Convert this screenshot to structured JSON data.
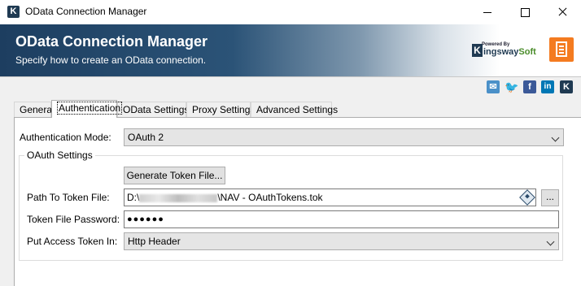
{
  "window": {
    "title": "OData Connection Manager",
    "app_icon": "K"
  },
  "banner": {
    "title": "OData Connection Manager",
    "subtitle": "Specify how to create an OData connection.",
    "logo": {
      "powered_by": "Powered By",
      "brand_k": "K",
      "brand_main": "ingsway",
      "brand_soft": "Soft"
    },
    "colors": {
      "dark": "#1d3e60",
      "accent": "#f47b20"
    }
  },
  "social": {
    "twitter": "t",
    "facebook": "f",
    "linkedin": "in",
    "kingsway": "K"
  },
  "tabs": [
    {
      "label": "General"
    },
    {
      "label": "Authentication",
      "active": true
    },
    {
      "label": "OData Settings"
    },
    {
      "label": "Proxy Settings"
    },
    {
      "label": "Advanced Settings"
    }
  ],
  "form": {
    "auth_mode_label": "Authentication Mode:",
    "auth_mode_value": "OAuth 2",
    "oauth_group_title": "OAuth Settings",
    "generate_button": "Generate Token File...",
    "token_path_label": "Path To Token File:",
    "token_path_prefix": "D:\\",
    "token_path_suffix": "\\NAV - OAuthTokens.tok",
    "browse_button": "...",
    "password_label": "Token File Password:",
    "password_value": "●●●●●●",
    "access_token_label": "Put Access Token In:",
    "access_token_value": "Http Header"
  }
}
